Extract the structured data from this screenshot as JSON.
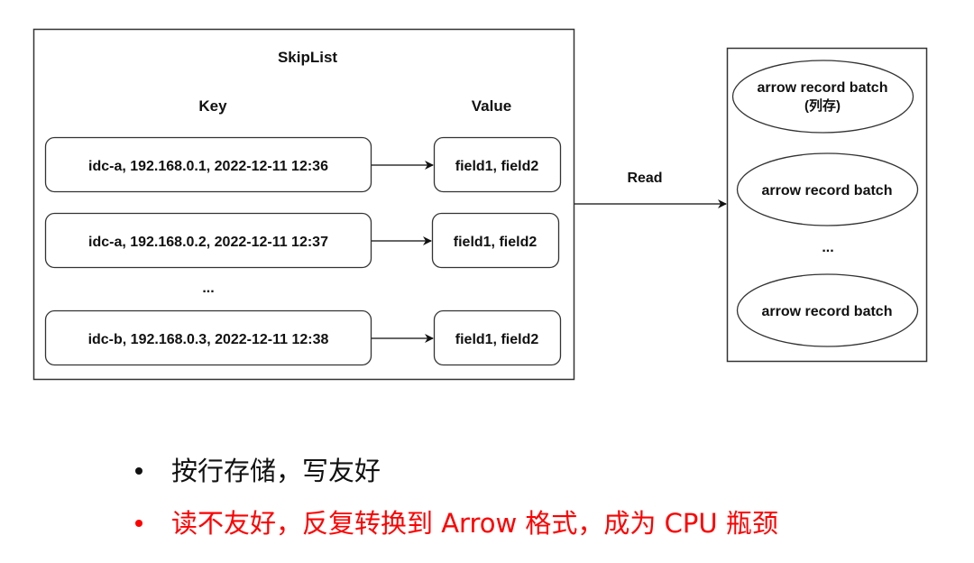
{
  "diagram": {
    "skiplist": {
      "title": "SkipList",
      "key_header": "Key",
      "value_header": "Value",
      "rows": [
        {
          "key": "idc-a, 192.168.0.1, 2022-12-11 12:36",
          "value": "field1, field2"
        },
        {
          "key": "idc-a, 192.168.0.2, 2022-12-11 12:37",
          "value": "field1, field2"
        },
        {
          "key": "idc-b, 192.168.0.3, 2022-12-11 12:38",
          "value": "field1, field2"
        }
      ],
      "ellipsis": "..."
    },
    "read_edge": {
      "label": "Read"
    },
    "arrow_store": {
      "batches": [
        {
          "line1": "arrow record batch",
          "line2": "(列存)"
        },
        {
          "line1": "arrow record batch"
        },
        {
          "line1": "arrow record batch"
        }
      ],
      "ellipsis": "..."
    }
  },
  "bullets": [
    {
      "text": "按行存储，写友好",
      "color": "#111111"
    },
    {
      "text": "读不友好，反复转换到 Arrow 格式，成为 CPU 瓶颈",
      "color": "#ff0000"
    }
  ]
}
